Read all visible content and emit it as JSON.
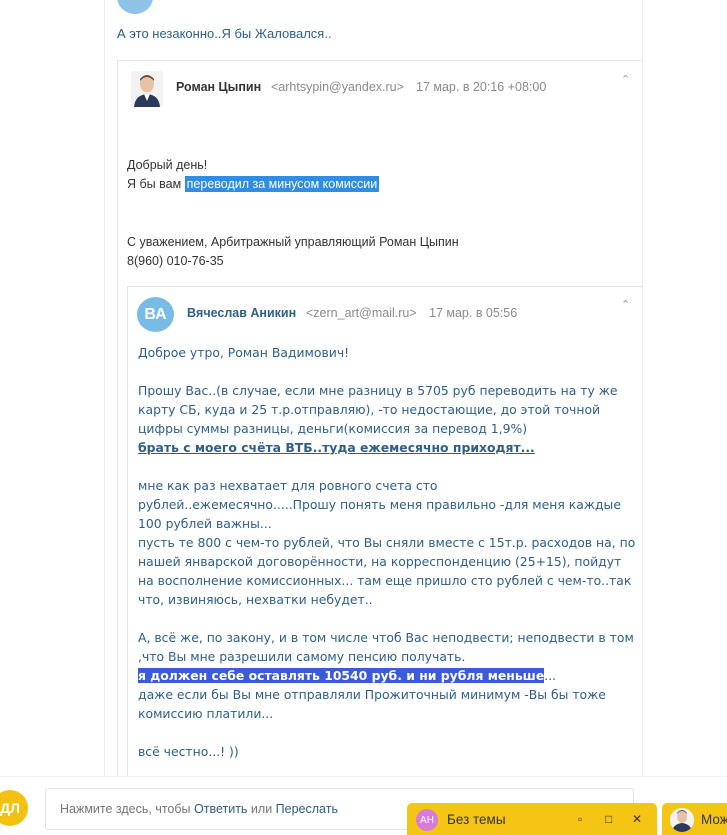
{
  "intro_text": "А это незаконно..Я бы Жаловался..",
  "message1": {
    "sender_name": "Роман Цыпин",
    "sender_email": "<arhtsypin@yandex.ru>",
    "date": "17 мар. в 20:16 +08:00",
    "greeting": "Добрый день!",
    "line_prefix": "Я бы вам ",
    "line_highlight": "переводил за минусом комиссии",
    "signature_line1": "С уважением, Арбитражный управляющий Роман Цыпин",
    "signature_line2": "8(960) 010-76-35"
  },
  "message2": {
    "avatar_initials": "ВА",
    "sender_name": "Вячеслав Аникин",
    "sender_email": "<zern_art@mail.ru>",
    "date": "17 мар. в 05:56",
    "p1": "Доброе утро, Роман Вадимович!",
    "p2_a": "Прошу Вас..(в случае, если мне разницу в 5705 руб переводить на ту же карту СБ, куда и 25 т.р.отправляю),   -то недостающие, до этой точной цифры суммы разницы, деньги(комиссия за перевод 1,9%)",
    "p2_b": "брать с моего счёта ВТБ..туда ежемесячно приходят...",
    "p3": "мне как раз нехватает   для ровного счета сто рублей..ежемесячно.....Прошу понять меня правильно -для меня каждые 100 рублей важны...",
    "p4": "пусть те 800 с чем-то рублей, что Вы сняли вместе с 15т.р. расходов на, по нашей январской договорённости, на корреспонденцию (25+15),  пойдут на восполнение комиссионных... там еще пришло сто рублей с чем-то..так что, извиняюсь, нехватки небудет..",
    "p5": "А, всё же, по закону, и в том числе чтоб Вас неподвести; неподвести в том ,что Вы мне разрешили самому пенсию получать.",
    "p6_highlight": "я должен себе оставлять 10540 руб. и ни рубля меньше",
    "p6_tail": "...",
    "p7": "даже если бы Вы мне отправляли Прожиточный минимум -Вы бы тоже комиссию платили...",
    "p8": "всё честно...! ))"
  },
  "reply": {
    "avatar_initials": "ДЛ",
    "prefix": "Нажмите здесь, чтобы ",
    "reply_label": "Ответить",
    "or": " или ",
    "forward_label": "Переслать"
  },
  "tabs": [
    {
      "initials": "АН",
      "title": "Без темы"
    },
    {
      "title": "Мож"
    }
  ],
  "colors": {
    "accent": "#2d5f8b",
    "highlight1": "#2f8de4",
    "highlight2": "#3b5bdb",
    "tab": "#f5c515"
  }
}
